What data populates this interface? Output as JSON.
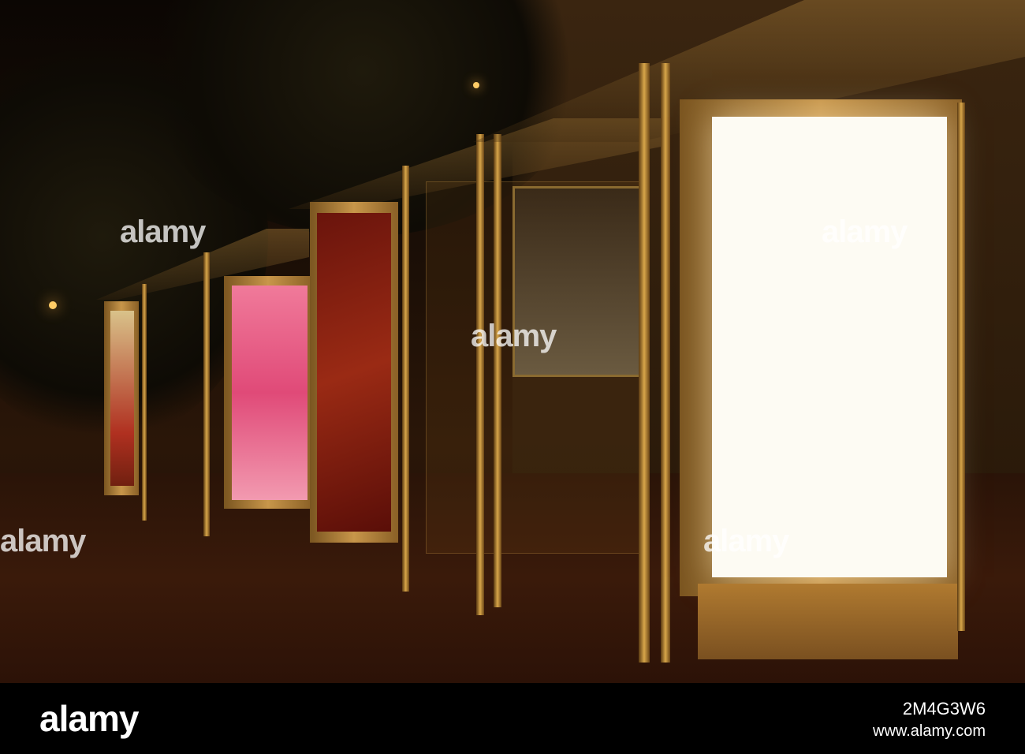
{
  "watermark": {
    "text": "alamy"
  },
  "footer": {
    "logo": "alamy",
    "image_id": "2M4G3W6",
    "url": "www.alamy.com"
  },
  "colors": {
    "billboard_white": "#fdfbf3",
    "pink_ad": "#e0567a",
    "frame_gold": "#c8964a"
  }
}
